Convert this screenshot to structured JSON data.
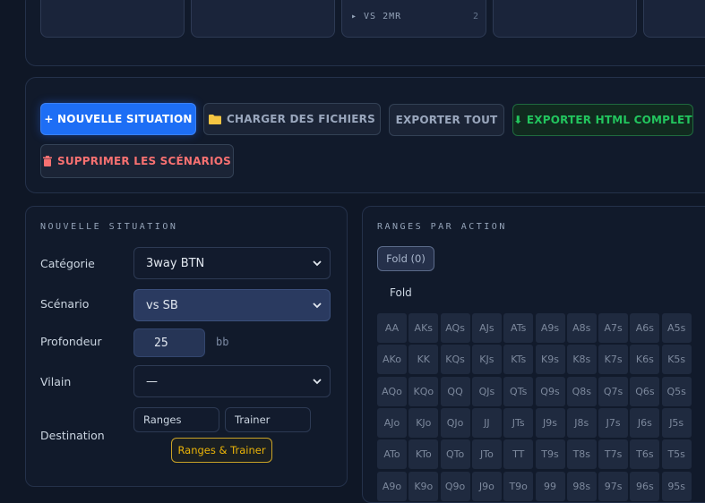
{
  "top_cards": [
    {
      "label": "",
      "count": ""
    },
    {
      "label": "",
      "count": ""
    },
    {
      "label": "▸ VS 2MR",
      "count": "2"
    },
    {
      "label": "",
      "count": ""
    },
    {
      "label": "",
      "count": ""
    }
  ],
  "actions": {
    "new_situation": "+ NOUVELLE SITUATION",
    "load_files": "CHARGER DES FICHIERS",
    "export_all": "EXPORTER TOUT",
    "export_html": "⬇ EXPORTER HTML COMPLET",
    "delete_scenarios": "SUPPRIMER LES SCÉNARIOS"
  },
  "form": {
    "title": "NOUVELLE SITUATION",
    "category_label": "Catégorie",
    "category_value": "3way BTN",
    "scenario_label": "Scénario",
    "scenario_value": "vs  SB",
    "depth_label": "Profondeur",
    "depth_value": "25",
    "depth_unit": "bb",
    "villain_label": "Vilain",
    "villain_value": "—",
    "destination_label": "Destination",
    "destination_options": [
      "Ranges",
      "Trainer",
      "Ranges & Trainer"
    ],
    "destination_selected": "Ranges & Trainer"
  },
  "ranges": {
    "title": "RANGES PAR ACTION",
    "chip": "Fold (0)",
    "action_label": "Fold",
    "rows": [
      [
        "AA",
        "AKs",
        "AQs",
        "AJs",
        "ATs",
        "A9s",
        "A8s",
        "A7s",
        "A6s",
        "A5s"
      ],
      [
        "AKo",
        "KK",
        "KQs",
        "KJs",
        "KTs",
        "K9s",
        "K8s",
        "K7s",
        "K6s",
        "K5s"
      ],
      [
        "AQo",
        "KQo",
        "QQ",
        "QJs",
        "QTs",
        "Q9s",
        "Q8s",
        "Q7s",
        "Q6s",
        "Q5s"
      ],
      [
        "AJo",
        "KJo",
        "QJo",
        "JJ",
        "JTs",
        "J9s",
        "J8s",
        "J7s",
        "J6s",
        "J5s"
      ],
      [
        "ATo",
        "KTo",
        "QTo",
        "JTo",
        "TT",
        "T9s",
        "T8s",
        "T7s",
        "T6s",
        "T5s"
      ],
      [
        "A9o",
        "K9o",
        "Q9o",
        "J9o",
        "T9o",
        "99",
        "98s",
        "97s",
        "96s",
        "95s"
      ]
    ]
  },
  "colors": {
    "accent": "#1d6ef5",
    "success": "#22c55e",
    "danger": "#f87171",
    "selected": "#eab308"
  }
}
